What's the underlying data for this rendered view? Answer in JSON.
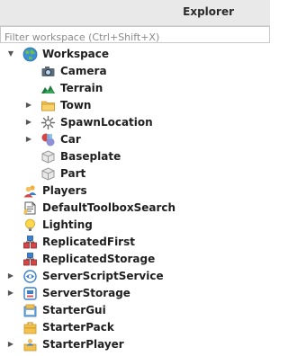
{
  "panel": {
    "title": "Explorer"
  },
  "filter": {
    "placeholder": "Filter workspace (Ctrl+Shift+X)"
  },
  "tree": [
    {
      "label": "Workspace",
      "icon": "globe-icon",
      "expander": "expanded"
    },
    {
      "label": "Camera",
      "icon": "camera-icon",
      "expander": ""
    },
    {
      "label": "Terrain",
      "icon": "terrain-icon",
      "expander": ""
    },
    {
      "label": "Town",
      "icon": "folder-icon",
      "expander": "collapsed"
    },
    {
      "label": "SpawnLocation",
      "icon": "spawn-location-icon",
      "expander": "collapsed"
    },
    {
      "label": "Car",
      "icon": "model-icon",
      "expander": "collapsed"
    },
    {
      "label": "Baseplate",
      "icon": "part-icon",
      "expander": ""
    },
    {
      "label": "Part",
      "icon": "part-icon",
      "expander": ""
    },
    {
      "label": "Players",
      "icon": "players-icon",
      "expander": ""
    },
    {
      "label": "DefaultToolboxSearch",
      "icon": "script-icon",
      "expander": ""
    },
    {
      "label": "Lighting",
      "icon": "lightbulb-icon",
      "expander": ""
    },
    {
      "label": "ReplicatedFirst",
      "icon": "replicated-icon",
      "expander": ""
    },
    {
      "label": "ReplicatedStorage",
      "icon": "replicated-icon",
      "expander": ""
    },
    {
      "label": "ServerScriptService",
      "icon": "server-script-service-icon",
      "expander": "collapsed"
    },
    {
      "label": "ServerStorage",
      "icon": "server-storage-icon",
      "expander": "collapsed"
    },
    {
      "label": "StarterGui",
      "icon": "starter-gui-icon",
      "expander": ""
    },
    {
      "label": "StarterPack",
      "icon": "starter-pack-icon",
      "expander": ""
    },
    {
      "label": "StarterPlayer",
      "icon": "starter-player-icon",
      "expander": "collapsed"
    }
  ]
}
